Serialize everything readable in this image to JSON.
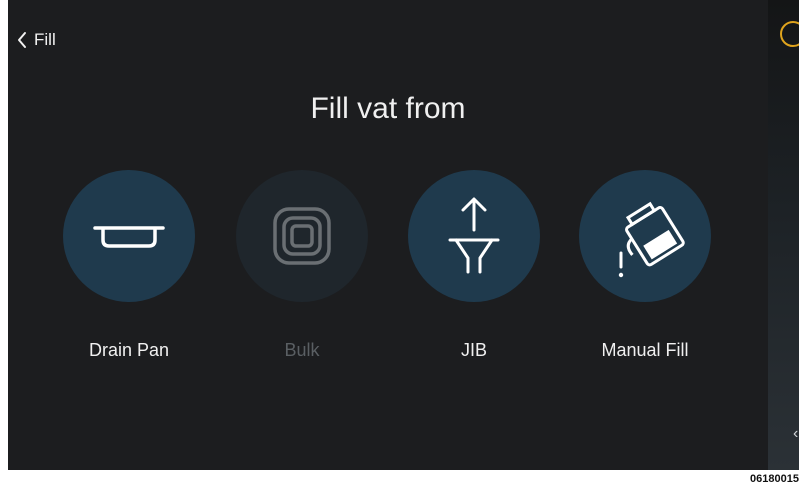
{
  "nav": {
    "back_label": "Fill"
  },
  "title": "Fill vat from",
  "options": [
    {
      "label": "Drain Pan",
      "icon": "drain-pan-icon",
      "enabled": true
    },
    {
      "label": "Bulk",
      "icon": "bulk-icon",
      "enabled": false
    },
    {
      "label": "JIB",
      "icon": "funnel-up-arrow-icon",
      "enabled": true
    },
    {
      "label": "Manual Fill",
      "icon": "pour-jug-icon",
      "enabled": true
    }
  ],
  "footer_code": "06180015",
  "colors": {
    "background": "#1c1d1f",
    "circle": "#1f3a4d",
    "circle_disabled": "#1f262c",
    "accent": "#e0a41d",
    "text": "#f0f0f0",
    "text_disabled": "#5a5f63"
  }
}
